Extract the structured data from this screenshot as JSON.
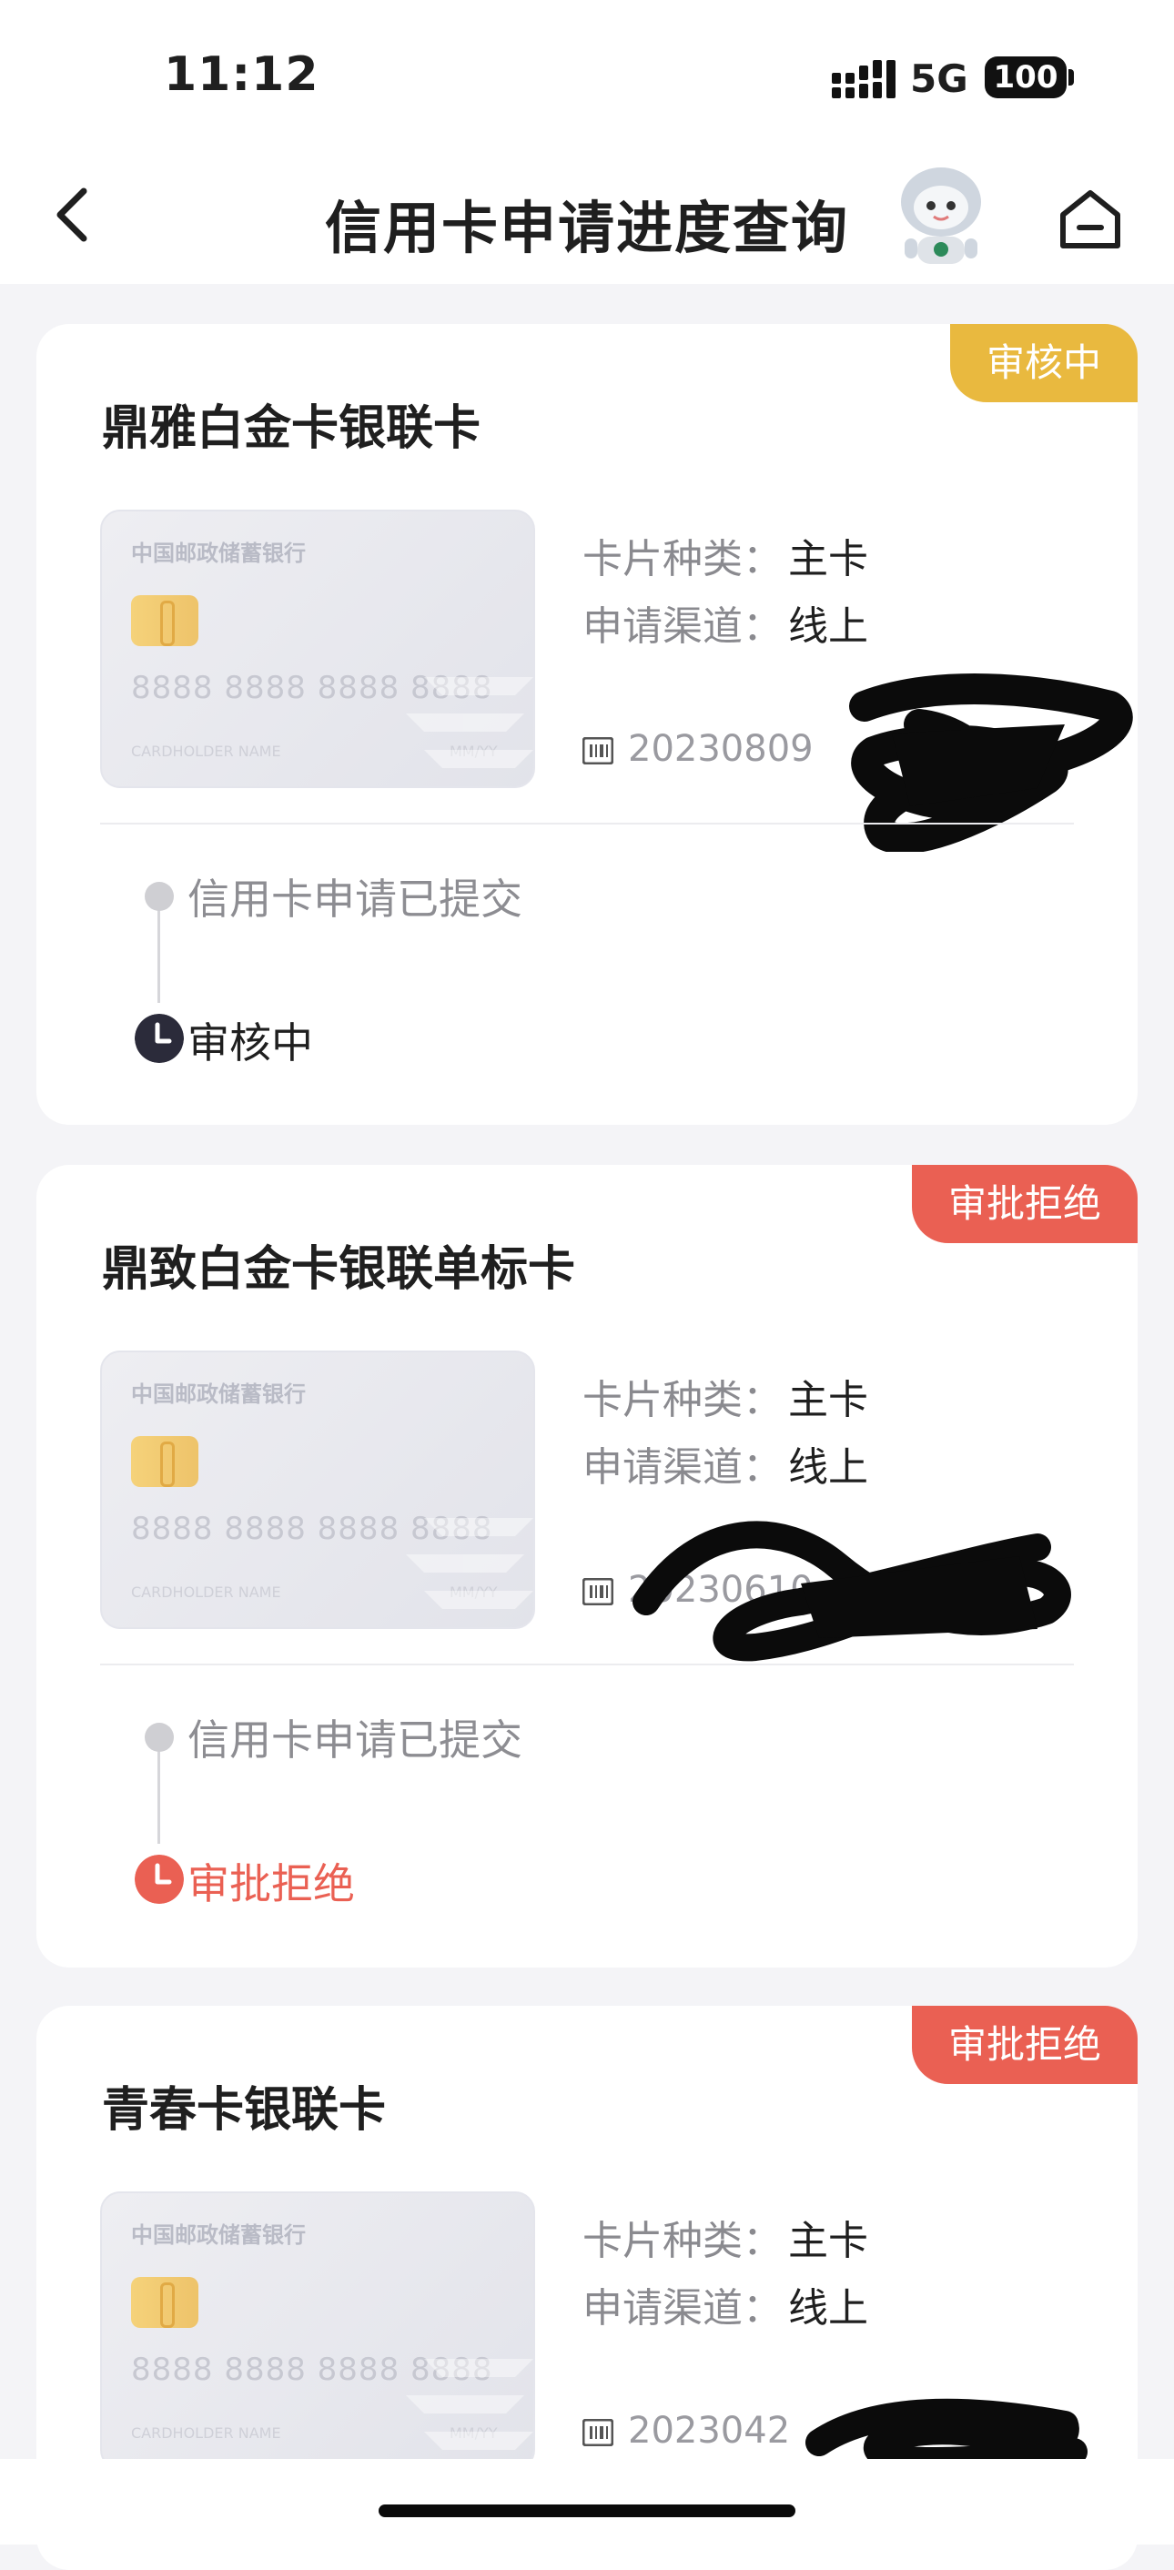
{
  "status_bar": {
    "time": "11:12",
    "network": "5G",
    "battery": "100"
  },
  "nav": {
    "title": "信用卡申请进度查询"
  },
  "labels": {
    "card_type": "卡片种类：",
    "channel": "申请渠道："
  },
  "card_face": {
    "bank": "中国邮政储蓄银行",
    "number": "8888 8888 8888 8888",
    "holder": "CARDHOLDER NAME",
    "expiry": "MM/YY"
  },
  "applications": [
    {
      "name": "鼎雅白金卡银联卡",
      "status": "审核中",
      "card_type": "主卡",
      "channel": "线上",
      "app_no": "20230809",
      "steps": [
        "信用卡申请已提交",
        "审核中"
      ]
    },
    {
      "name": "鼎致白金卡银联单标卡",
      "status": "审批拒绝",
      "card_type": "主卡",
      "channel": "线上",
      "app_no": "20230610",
      "steps": [
        "信用卡申请已提交",
        "审批拒绝"
      ]
    },
    {
      "name": "青春卡银联卡",
      "status": "审批拒绝",
      "card_type": "主卡",
      "channel": "线上",
      "app_no": "2023042"
    }
  ],
  "colors": {
    "review": "#e9b93f",
    "reject": "#ea6053",
    "current_clock": "#2b2b3a"
  }
}
